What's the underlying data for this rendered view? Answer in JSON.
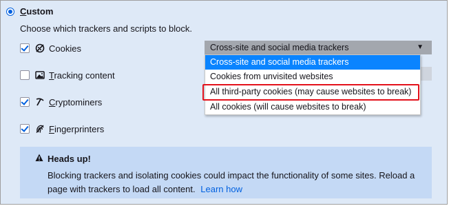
{
  "custom": {
    "label_prefix": "",
    "label_accesskey": "C",
    "label_rest": "ustom",
    "description": "Choose which trackers and scripts to block."
  },
  "options": [
    {
      "key": "cookies",
      "pre": "",
      "ak": "",
      "post": "Cookies",
      "checked": true,
      "icon": "cookie-icon"
    },
    {
      "key": "tracking",
      "pre": "",
      "ak": "T",
      "post": "racking content",
      "checked": false,
      "icon": "image-icon"
    },
    {
      "key": "crypto",
      "pre": "",
      "ak": "C",
      "post": "ryptominers",
      "checked": true,
      "icon": "cryptominer-icon"
    },
    {
      "key": "finger",
      "pre": "",
      "ak": "F",
      "post": "ingerprinters",
      "checked": true,
      "icon": "fingerprint-icon"
    }
  ],
  "cookie_select": {
    "value": "Cross-site and social media trackers",
    "options": [
      "Cross-site and social media trackers",
      "Cookies from unvisited websites",
      "All third-party cookies (may cause websites to break)",
      "All cookies (will cause websites to break)"
    ]
  },
  "heads_up": {
    "title": "Heads up!",
    "body": "Blocking trackers and isolating cookies could impact the functionality of some sites. Reload a page with trackers to load all content.",
    "link": "Learn how"
  },
  "colors": {
    "panel_bg": "#dee9f7",
    "accent": "#0060df",
    "selected_option": "#0a84ff",
    "highlight_border": "#e3101a",
    "notice_bg": "#c4d9f5"
  }
}
